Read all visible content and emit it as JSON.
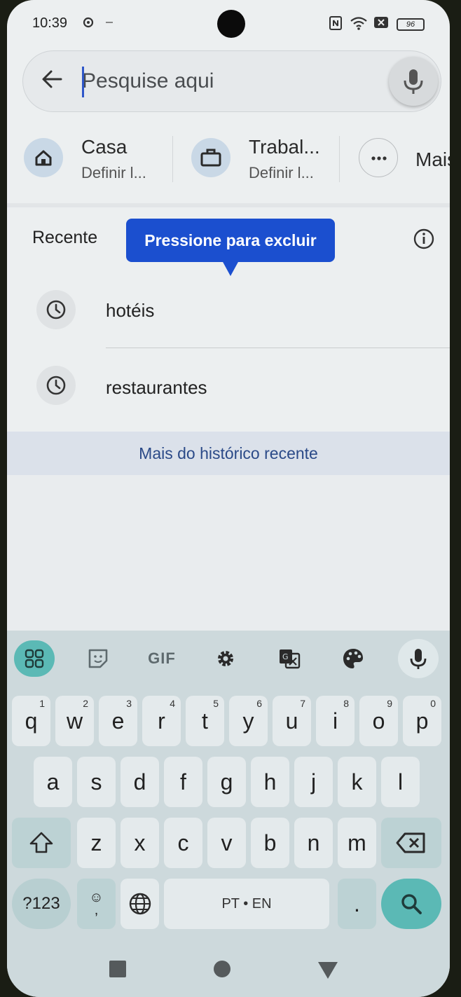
{
  "status_bar": {
    "time": "10:39",
    "battery": "96",
    "icons": [
      "settings-icon",
      "nfc-icon",
      "wifi-icon",
      "sim-icon",
      "battery-icon"
    ]
  },
  "search": {
    "placeholder": "Pesquise aqui",
    "value": "",
    "mic_icon": "mic-icon",
    "back_icon": "back-arrow-icon"
  },
  "shortcuts": [
    {
      "title": "Casa",
      "subtitle": "Definir l...",
      "icon": "home-icon"
    },
    {
      "title": "Trabal...",
      "subtitle": "Definir l...",
      "icon": "briefcase-icon"
    },
    {
      "title": "Mais",
      "subtitle": "",
      "icon": "more-icon"
    }
  ],
  "recent": {
    "label": "Recente",
    "tooltip": "Pressione para excluir",
    "items": [
      {
        "text": "hotéis",
        "icon": "clock-icon"
      },
      {
        "text": "restaurantes",
        "icon": "clock-icon"
      }
    ],
    "more_link": "Mais do histórico recente"
  },
  "keyboard": {
    "toolbar": [
      "apps-grid-icon",
      "sticker-icon",
      "GIF",
      "gear-icon",
      "translate-icon",
      "palette-icon",
      "mic-icon"
    ],
    "row1": [
      {
        "k": "q",
        "h": "1"
      },
      {
        "k": "w",
        "h": "2"
      },
      {
        "k": "e",
        "h": "3"
      },
      {
        "k": "r",
        "h": "4"
      },
      {
        "k": "t",
        "h": "5"
      },
      {
        "k": "y",
        "h": "6"
      },
      {
        "k": "u",
        "h": "7"
      },
      {
        "k": "i",
        "h": "8"
      },
      {
        "k": "o",
        "h": "9"
      },
      {
        "k": "p",
        "h": "0"
      }
    ],
    "row2": [
      "a",
      "s",
      "d",
      "f",
      "g",
      "h",
      "j",
      "k",
      "l"
    ],
    "row3": [
      "z",
      "x",
      "c",
      "v",
      "b",
      "n",
      "m"
    ],
    "sym_key": "?123",
    "emoji_key": "☺",
    "comma_key": ",",
    "space_label": "PT • EN",
    "period_key": "."
  },
  "colors": {
    "accent": "#1b4fcf",
    "keyboard_accent": "#5bb9b5",
    "link": "#2b4a88"
  }
}
